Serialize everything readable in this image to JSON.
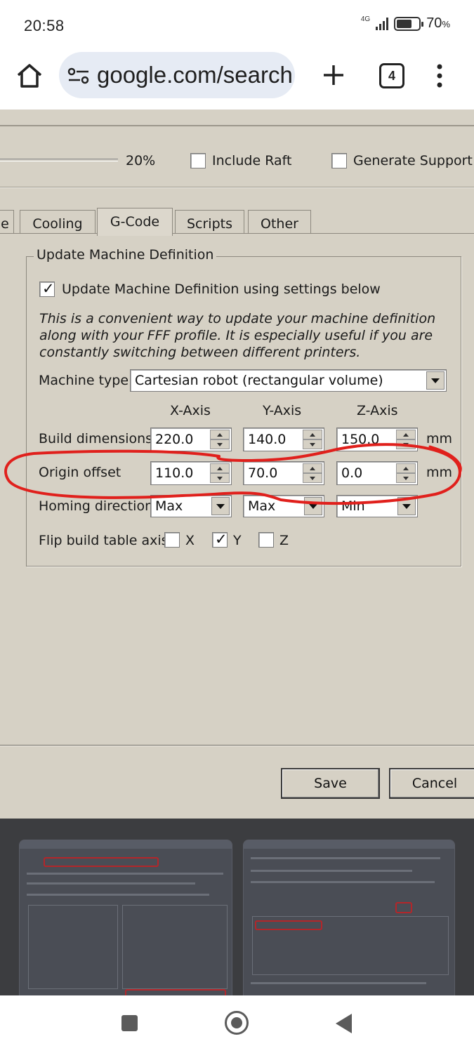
{
  "status_bar": {
    "time": "20:58",
    "network": "4G",
    "battery_pct": "70",
    "battery_unit": "%",
    "battery_level": 0.7
  },
  "browser": {
    "url": "google.com/search",
    "tab_count": "4",
    "icons": [
      "home-icon",
      "site-settings-icon",
      "new-tab-icon",
      "tab-switcher-icon",
      "menu-icon"
    ]
  },
  "dialog": {
    "slider_value": "20%",
    "include_raft_label": "Include Raft",
    "include_raft_checked": false,
    "generate_support_label": "Generate Support",
    "generate_support_checked": false,
    "tabs": [
      "e",
      "Cooling",
      "G-Code",
      "Scripts",
      "Other"
    ],
    "active_tab": "G-Code",
    "group_title": "Update Machine Definition",
    "update_checkbox_label": "Update Machine Definition using settings below",
    "update_checked": true,
    "description": "This is a convenient way to update your machine definition along with your FFF profile.  It is especially useful if you are constantly switching between different printers.",
    "machine_type_label": "Machine type",
    "machine_type_value": "Cartesian robot (rectangular volume)",
    "axis_headers": [
      "X-Axis",
      "Y-Axis",
      "Z-Axis"
    ],
    "build_dimensions": {
      "label": "Build dimensions",
      "x": "220.0",
      "y": "140.0",
      "z": "150.0",
      "unit": "mm"
    },
    "origin_offset": {
      "label": "Origin offset",
      "x": "110.0",
      "y": "70.0",
      "z": "0.0",
      "unit": "mm"
    },
    "homing_direction": {
      "label": "Homing direction",
      "x": "Max",
      "y": "Max",
      "z": "Min"
    },
    "flip_axis": {
      "label": "Flip build table axis",
      "x_label": "X",
      "y_label": "Y",
      "z_label": "Z",
      "x_checked": false,
      "y_checked": true,
      "z_checked": false
    },
    "save_label": "Save",
    "cancel_label": "Cancel",
    "annotation_color": "#e0201c"
  },
  "nav_bar": {
    "icons": [
      "recents-icon",
      "home-circle-icon",
      "back-icon"
    ]
  }
}
